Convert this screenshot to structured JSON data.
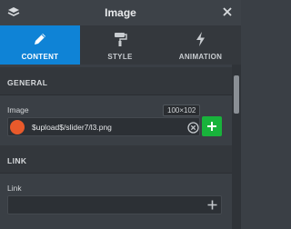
{
  "header": {
    "title": "Image"
  },
  "tabs": [
    {
      "label": "CONTENT",
      "icon": "pencil-icon",
      "active": true
    },
    {
      "label": "STYLE",
      "icon": "paint-roller-icon",
      "active": false
    },
    {
      "label": "ANIMATION",
      "icon": "lightning-icon",
      "active": false
    }
  ],
  "sections": {
    "general": {
      "title": "GENERAL",
      "image_label": "Image",
      "image_value": "$upload$/slider7/l3.png",
      "image_size": "100×102"
    },
    "link": {
      "title": "LINK",
      "link_label": "Link",
      "link_value": ""
    }
  },
  "colors": {
    "accent": "#0f83d6",
    "add_button": "#18b33b"
  }
}
